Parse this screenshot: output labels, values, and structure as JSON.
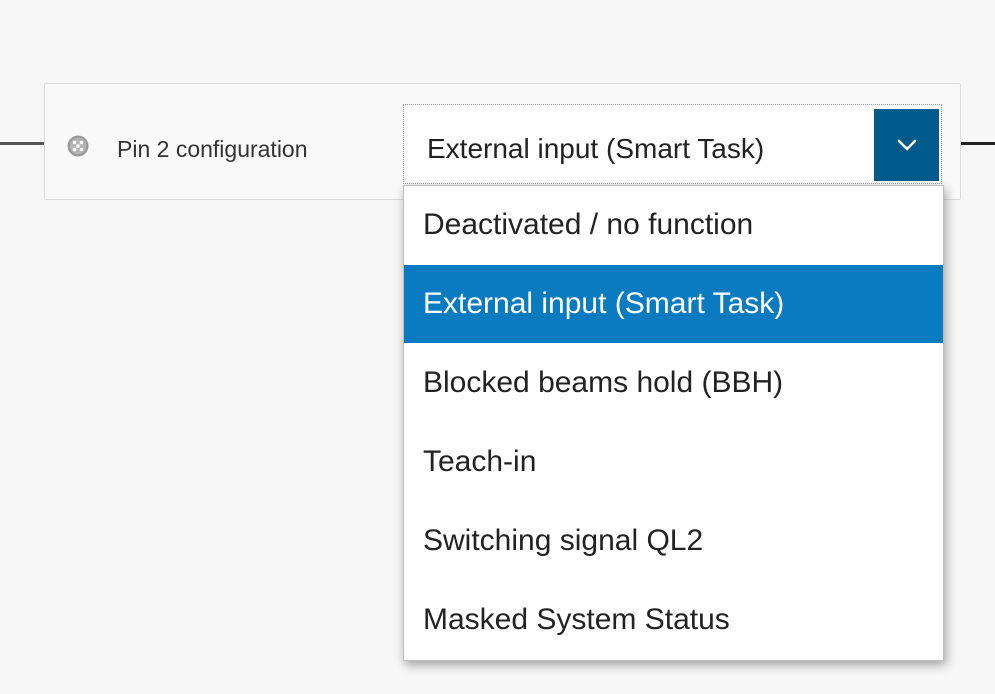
{
  "pin_config": {
    "label": "Pin 2 configuration",
    "icon": "connector-pin-icon",
    "selected_value": "External input (Smart Task)",
    "dropdown_icon": "chevron-down-icon"
  },
  "dropdown": {
    "options": [
      {
        "label": "Deactivated / no function",
        "selected": false
      },
      {
        "label": "External input (Smart Task)",
        "selected": true
      },
      {
        "label": "Blocked beams hold (BBH)",
        "selected": false
      },
      {
        "label": "Teach-in",
        "selected": false
      },
      {
        "label": "Switching signal QL2",
        "selected": false
      },
      {
        "label": "Masked System Status",
        "selected": false
      }
    ]
  },
  "colors": {
    "dropdown_button": "#005a8c",
    "selected_option": "#0a7bc1",
    "selected_option_text": "#ffffff"
  }
}
